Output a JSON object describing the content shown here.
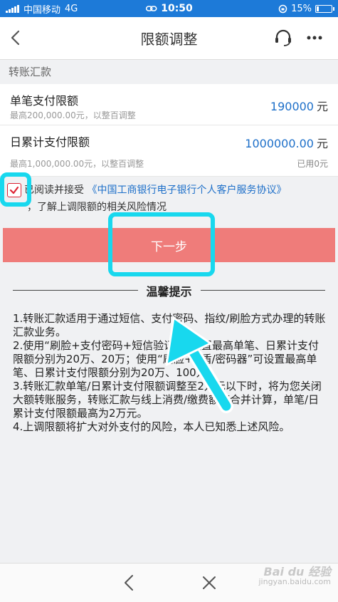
{
  "status_bar": {
    "carrier": "中国移动",
    "network": "4G",
    "time": "10:50",
    "battery_text": "15%",
    "battery_level": 0.15
  },
  "nav": {
    "title": "限额调整",
    "back_icon": "chevron-left-icon",
    "service_icon": "headset-icon",
    "more_icon": "more-dots-icon"
  },
  "section": {
    "title": "转账汇款"
  },
  "limits": [
    {
      "label": "单笔支付限额",
      "hint": "最高200,000.00元，以整百调整",
      "value": "190000",
      "unit": "元"
    },
    {
      "label": "日累计支付限额",
      "hint": "最高1,000,000.00元，以整百调整",
      "value": "1000000.00",
      "unit": "元",
      "used": "已用0元"
    }
  ],
  "agreement": {
    "checked": true,
    "prefix": "已阅读并接受",
    "link": "《中国工商银行电子银行个人客户服务协议》",
    "line2": "，了解上调限额的相关风险情况"
  },
  "next_button": {
    "label": "下一步"
  },
  "tips": {
    "title": "温馨提示",
    "items": [
      "1.转账汇款适用于通过短信、支付密码、指纹/刷脸方式办理的转账汇款业务。",
      "2.使用“刷脸+支付密码+短信验证”可设置最高单笔、日累计支付限额分别为20万、20万；使用“刷脸+U盾/密码器”可设置最高单笔、日累计支付限额分别为20万、100万。",
      "3.转账汇款单笔/日累计支付限额调整至2万元以下时，将为您关闭大额转账服务，转账汇款与线上消费/缴费额度合并计算，单笔/日累计支付限额最高为2万元。",
      "4.上调限额将扩大对外支付的风险，本人已知悉上述风险。"
    ]
  },
  "bottom_bar": {
    "back_icon": "chevron-left-icon",
    "close_icon": "close-icon"
  },
  "watermark": {
    "brand": "Bai du 经验",
    "url": "jingyan.baidu.com"
  },
  "colors": {
    "status_bar": "#1d7ad8",
    "link_blue": "#1d6fc9",
    "button_red": "#ef7c7a",
    "highlight_cyan": "#18d8ee",
    "page_bg": "#f0f1f3"
  }
}
